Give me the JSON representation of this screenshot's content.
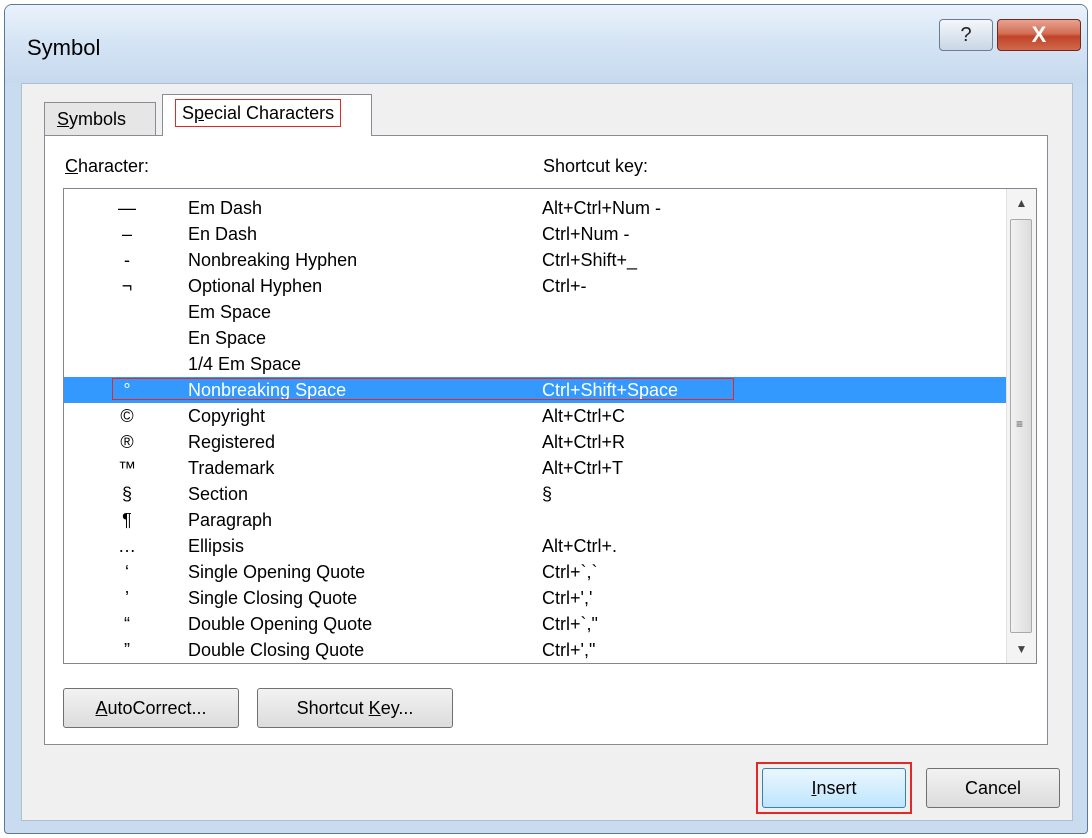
{
  "window": {
    "title": "Symbol",
    "help_label": "?",
    "close_label": "X"
  },
  "tabs": {
    "symbols_pre": "",
    "symbols_accel": "S",
    "symbols_post": "ymbols",
    "special_pre": "S",
    "special_accel": "p",
    "special_post": "ecial Characters"
  },
  "columns": {
    "character_accel": "C",
    "character_rest": "haracter:",
    "shortcut": "Shortcut key:"
  },
  "rows": [
    {
      "char": "—",
      "name": "Em Dash",
      "key": "Alt+Ctrl+Num -"
    },
    {
      "char": "–",
      "name": "En Dash",
      "key": "Ctrl+Num -"
    },
    {
      "char": "-",
      "name": "Nonbreaking Hyphen",
      "key": "Ctrl+Shift+_"
    },
    {
      "char": "¬",
      "name": "Optional Hyphen",
      "key": "Ctrl+-"
    },
    {
      "char": "",
      "name": "Em Space",
      "key": ""
    },
    {
      "char": "",
      "name": "En Space",
      "key": ""
    },
    {
      "char": "",
      "name": "1/4 Em Space",
      "key": ""
    },
    {
      "char": "°",
      "name": "Nonbreaking Space",
      "key": "Ctrl+Shift+Space"
    },
    {
      "char": "©",
      "name": "Copyright",
      "key": "Alt+Ctrl+C"
    },
    {
      "char": "®",
      "name": "Registered",
      "key": "Alt+Ctrl+R"
    },
    {
      "char": "™",
      "name": "Trademark",
      "key": "Alt+Ctrl+T"
    },
    {
      "char": "§",
      "name": "Section",
      "key": "§"
    },
    {
      "char": "¶",
      "name": "Paragraph",
      "key": ""
    },
    {
      "char": "…",
      "name": "Ellipsis",
      "key": "Alt+Ctrl+."
    },
    {
      "char": "‘",
      "name": "Single Opening Quote",
      "key": "Ctrl+`,`"
    },
    {
      "char": "’",
      "name": "Single Closing Quote",
      "key": "Ctrl+','"
    },
    {
      "char": "“",
      "name": "Double Opening Quote",
      "key": "Ctrl+`,\""
    },
    {
      "char": "”",
      "name": "Double Closing Quote",
      "key": "Ctrl+',\""
    }
  ],
  "selected_row": "Nonbreaking Space",
  "scrollbar": {
    "up_icon": "▲",
    "down_icon": "▼",
    "grip_icon": "≡"
  },
  "buttons": {
    "autocorrect_accel": "A",
    "autocorrect_rest": "utoCorrect...",
    "shortcut_pre": "Shortcut ",
    "shortcut_accel": "K",
    "shortcut_post": "ey...",
    "insert_accel": "I",
    "insert_rest": "nsert",
    "cancel": "Cancel"
  },
  "colors": {
    "selection": "#3399ff",
    "annotation_red": "#e02a2a",
    "dialog_frame": "#c9dbee"
  }
}
